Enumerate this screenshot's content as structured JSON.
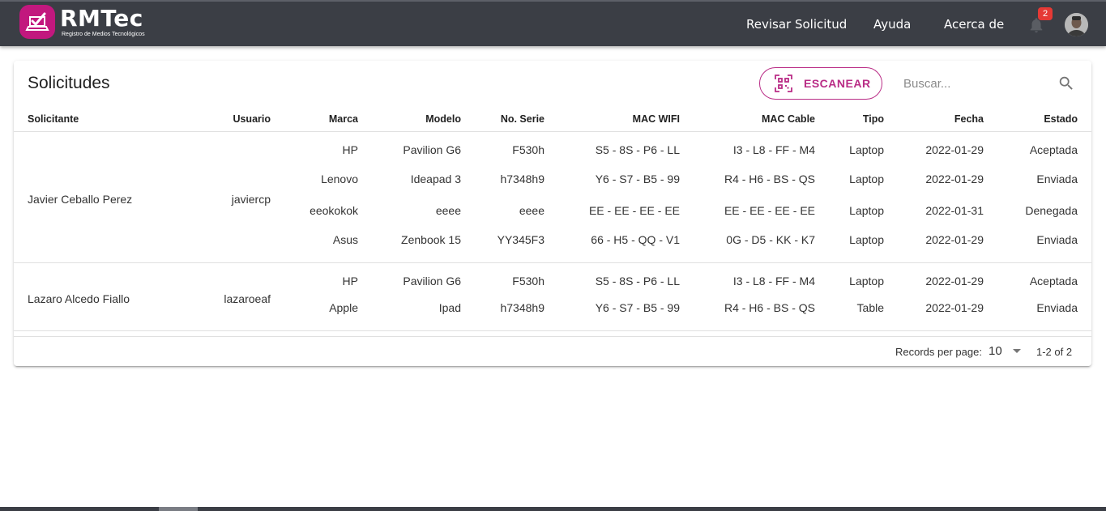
{
  "app": {
    "name": "RMTec",
    "subtitle": "Registro de Medios Tecnológicos"
  },
  "nav": {
    "items": [
      "Revisar Solicitud",
      "Ayuda",
      "Acerca de"
    ],
    "notification_count": "2"
  },
  "main": {
    "title": "Solicitudes",
    "scan_label": "ESCANEAR",
    "search_placeholder": "Buscar..."
  },
  "table": {
    "headers": [
      "Solicitante",
      "Usuario",
      "Marca",
      "Modelo",
      "No. Serie",
      "MAC WIFI",
      "MAC Cable",
      "Tipo",
      "Fecha",
      "Estado"
    ],
    "groups": [
      {
        "solicitante": "Javier Ceballo Perez",
        "usuario": "javiercp",
        "devices": [
          {
            "marca": "HP",
            "modelo": "Pavilion G6",
            "serie": "F530h",
            "mac_wifi": "S5 - 8S - P6 - LL",
            "mac_cable": "I3 - L8 - FF - M4",
            "tipo": "Laptop",
            "fecha": "2022-01-29",
            "estado": "Aceptada"
          },
          {
            "marca": "Lenovo",
            "modelo": "Ideapad 3",
            "serie": "h7348h9",
            "mac_wifi": "Y6 - S7 - B5 - 99",
            "mac_cable": "R4 - H6 - BS - QS",
            "tipo": "Laptop",
            "fecha": "2022-01-29",
            "estado": "Enviada"
          },
          {
            "marca": "eeokokok",
            "modelo": "eeee",
            "serie": "eeee",
            "mac_wifi": "EE - EE - EE - EE",
            "mac_cable": "EE - EE - EE - EE",
            "tipo": "Laptop",
            "fecha": "2022-01-31",
            "estado": "Denegada"
          },
          {
            "marca": "Asus",
            "modelo": "Zenbook 15",
            "serie": "YY345F3",
            "mac_wifi": "66 - H5 - QQ - V1",
            "mac_cable": "0G - D5 - KK - K7",
            "tipo": "Laptop",
            "fecha": "2022-01-29",
            "estado": "Enviada"
          }
        ]
      },
      {
        "solicitante": "Lazaro Alcedo Fiallo",
        "usuario": "lazaroeaf",
        "devices": [
          {
            "marca": "HP",
            "modelo": "Pavilion G6",
            "serie": "F530h",
            "mac_wifi": "S5 - 8S - P6 - LL",
            "mac_cable": "I3 - L8 - FF - M4",
            "tipo": "Laptop",
            "fecha": "2022-01-29",
            "estado": "Aceptada"
          },
          {
            "marca": "Apple",
            "modelo": "Ipad",
            "serie": "h7348h9",
            "mac_wifi": "Y6 - S7 - B5 - 99",
            "mac_cable": "R4 - H6 - BS - QS",
            "tipo": "Table",
            "fecha": "2022-01-29",
            "estado": "Enviada"
          }
        ]
      }
    ]
  },
  "pagination": {
    "records_label": "Records per page:",
    "per_page": "10",
    "range": "1-2 of 2"
  },
  "colors": {
    "topbar": "#3b3e45",
    "accent": "#b92c86",
    "badge": "#e53935"
  }
}
